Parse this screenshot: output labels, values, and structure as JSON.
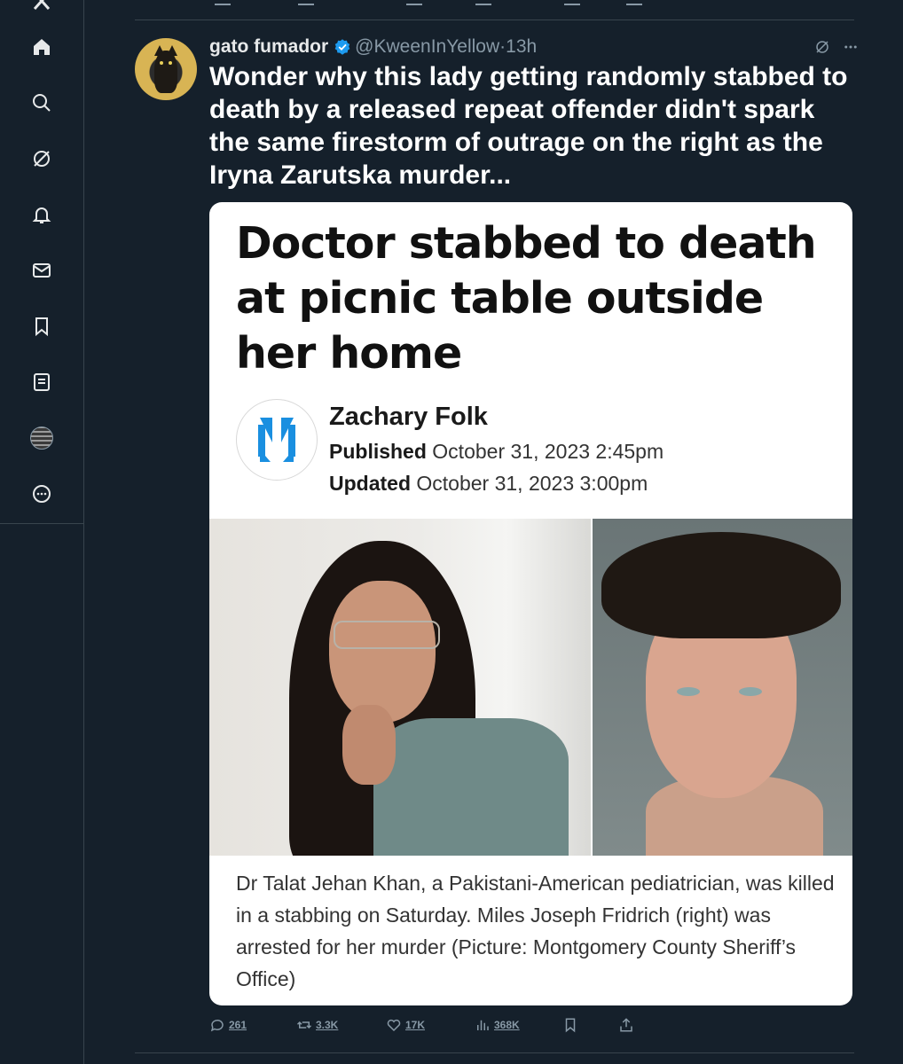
{
  "tweet": {
    "author_name": "gato fumador",
    "handle": "@KweenInYellow",
    "separator": "·",
    "time": "13h",
    "text": "Wonder why this lady getting randomly stabbed to death by a released repeat offender didn't spark the same firestorm of outrage on the right as the Iryna Zarutska murder..."
  },
  "article": {
    "headline": "Doctor stabbed to death at picnic table outside her home",
    "author": "Zachary Folk",
    "published_label": "Published",
    "published_date": "October 31, 2023 2:45pm",
    "updated_label": "Updated",
    "updated_date": "October 31, 2023 3:00pm",
    "caption": "Dr Talat Jehan Khan, a Pakistani-American pediatrician, was killed in a stabbing on Saturday. Miles Joseph Fridrich (right) was arrested for her murder (Picture: Montgomery County Sheriff’s Office)"
  },
  "actions": {
    "replies": "261",
    "reposts": "3.3K",
    "likes": "17K",
    "views": "368K"
  },
  "colors": {
    "background": "#15202b",
    "muted": "#8899a6",
    "verified": "#1d9bf0",
    "metro_blue": "#1a8fe0"
  },
  "nav_icons": [
    "x-logo-icon",
    "home-icon",
    "search-icon",
    "grok-icon",
    "notifications-icon",
    "messages-icon",
    "bookmarks-icon",
    "lists-icon",
    "profile-avatar",
    "more-icon"
  ]
}
